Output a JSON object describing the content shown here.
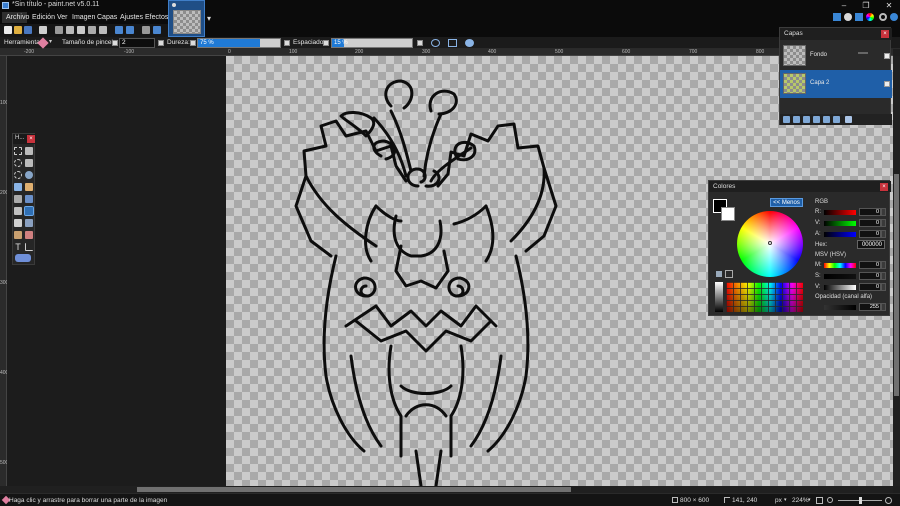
{
  "window": {
    "title": "*Sin título - paint.net v5.0.11",
    "btn_min": "–",
    "btn_max": "❐",
    "btn_close": "✕"
  },
  "menu": [
    "Archivo",
    "Edición",
    "Ver",
    "Imagen",
    "Capas",
    "Ajustes",
    "Efectos"
  ],
  "options": {
    "tool_label": "Herramienta:",
    "brush_size_label": "Tamaño de pincel:",
    "brush_size_value": "2",
    "hardness_label": "Dureza:",
    "hardness_value": "75 %",
    "hardness_fraction": 0.75,
    "spacing_label": "Espaciado:",
    "spacing_value": "15 %",
    "spacing_fraction": 0.15
  },
  "ruler_top": [
    "-200",
    "-100",
    "0",
    "100",
    "200",
    "300",
    "400",
    "500",
    "600",
    "700",
    "800",
    "900",
    "1000",
    "1100",
    "1200",
    "1300",
    "1400"
  ],
  "ruler_left": [
    "100",
    "200",
    "300",
    "400",
    "500"
  ],
  "tools_window": {
    "title": "H...",
    "close": "×"
  },
  "layers": {
    "title": "Capas",
    "close": "×",
    "items": [
      {
        "name": "Fondo",
        "visible": true,
        "selected": false
      },
      {
        "name": "Capa 2",
        "visible": true,
        "selected": true
      }
    ]
  },
  "colors": {
    "title": "Colores",
    "close": "×",
    "less_button": "<< Menos",
    "rgb_label": "RGB",
    "r_label": "R:",
    "g_label": "V:",
    "b_label": "A:",
    "r": "0",
    "g": "0",
    "b": "0",
    "hex_label": "Hex:",
    "hex": "000000",
    "hsv_label": "MSV (HSV)",
    "h_label": "M:",
    "s_label": "S:",
    "v_label": "V:",
    "h": "0",
    "s": "0",
    "v": "0",
    "alpha_label": "Opacidad (canal alfa)",
    "alpha": "255"
  },
  "status": {
    "hint": "Haga clic y arrastre para borrar una parte de la imagen",
    "image_size": "800 × 600",
    "cursor_pos": "141, 240",
    "unit": "px",
    "zoom": "224%"
  },
  "colors_accent": {
    "selection": "#1f5fa8",
    "slider": "#1f7ad6",
    "close": "#c8323c"
  }
}
